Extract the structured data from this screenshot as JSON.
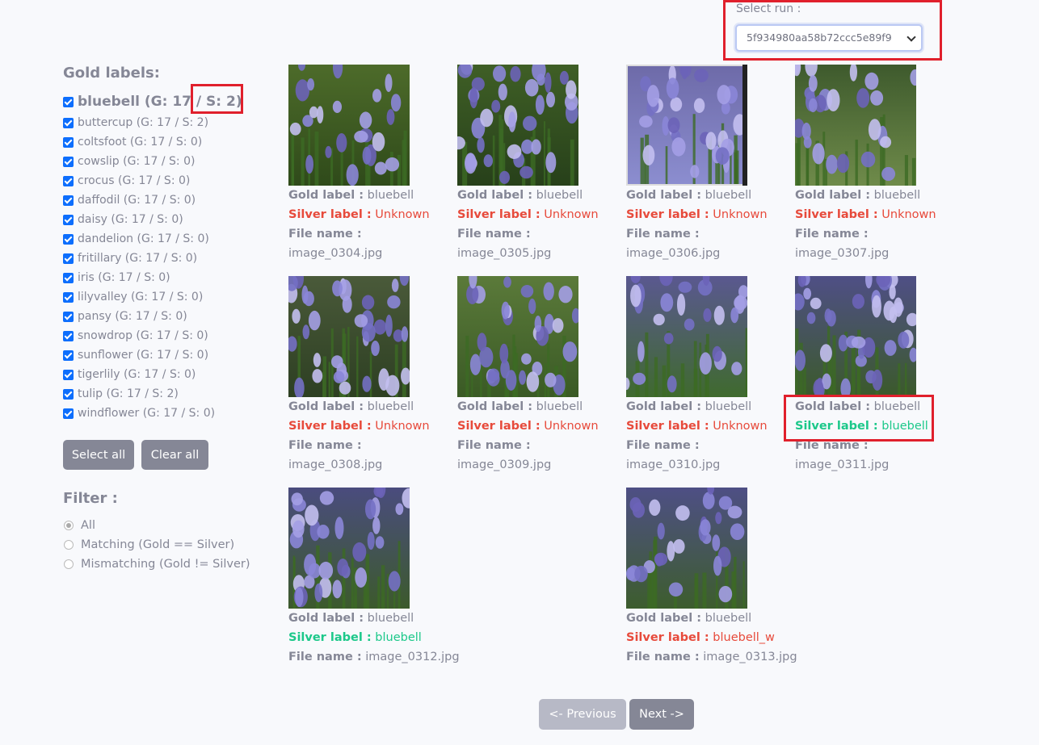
{
  "run_selector": {
    "label": "Select run :",
    "value": "5f934980aa58b72ccc5e89f9"
  },
  "gold_labels": {
    "title": "Gold labels:",
    "items": [
      {
        "label": "bluebell (G: 17 / S: 2)",
        "checked": true
      },
      {
        "label": "buttercup (G: 17 / S: 2)",
        "checked": true
      },
      {
        "label": "coltsfoot (G: 17 / S: 0)",
        "checked": true
      },
      {
        "label": "cowslip (G: 17 / S: 0)",
        "checked": true
      },
      {
        "label": "crocus (G: 17 / S: 0)",
        "checked": true
      },
      {
        "label": "daffodil (G: 17 / S: 0)",
        "checked": true
      },
      {
        "label": "daisy (G: 17 / S: 0)",
        "checked": true
      },
      {
        "label": "dandelion (G: 17 / S: 0)",
        "checked": true
      },
      {
        "label": "fritillary (G: 17 / S: 0)",
        "checked": true
      },
      {
        "label": "iris (G: 17 / S: 0)",
        "checked": true
      },
      {
        "label": "lilyvalley (G: 17 / S: 0)",
        "checked": true
      },
      {
        "label": "pansy (G: 17 / S: 0)",
        "checked": true
      },
      {
        "label": "snowdrop (G: 17 / S: 0)",
        "checked": true
      },
      {
        "label": "sunflower (G: 17 / S: 0)",
        "checked": true
      },
      {
        "label": "tigerlily (G: 17 / S: 0)",
        "checked": true
      },
      {
        "label": "tulip (G: 17 / S: 2)",
        "checked": true
      },
      {
        "label": "windflower (G: 17 / S: 0)",
        "checked": true
      }
    ],
    "select_all": "Select all",
    "clear_all": "Clear all"
  },
  "filter": {
    "title": "Filter :",
    "options": [
      {
        "label": "All",
        "selected": true
      },
      {
        "label": "Matching (Gold == Silver)",
        "selected": false
      },
      {
        "label": "Mismatching (Gold != Silver)",
        "selected": false
      }
    ]
  },
  "field_labels": {
    "gold": "Gold label :",
    "silver": "Silver label :",
    "file": "File name :"
  },
  "images": [
    {
      "gold": "bluebell",
      "silver": "Unknown",
      "match": false,
      "file": "image_0304.jpg"
    },
    {
      "gold": "bluebell",
      "silver": "Unknown",
      "match": false,
      "file": "image_0305.jpg"
    },
    {
      "gold": "bluebell",
      "silver": "Unknown",
      "match": false,
      "file": "image_0306.jpg"
    },
    {
      "gold": "bluebell",
      "silver": "Unknown",
      "match": false,
      "file": "image_0307.jpg"
    },
    {
      "gold": "bluebell",
      "silver": "Unknown",
      "match": false,
      "file": "image_0308.jpg"
    },
    {
      "gold": "bluebell",
      "silver": "Unknown",
      "match": false,
      "file": "image_0309.jpg"
    },
    {
      "gold": "bluebell",
      "silver": "Unknown",
      "match": false,
      "file": "image_0310.jpg"
    },
    {
      "gold": "bluebell",
      "silver": "bluebell",
      "match": true,
      "file": "image_0311.jpg"
    },
    {
      "gold": "bluebell",
      "silver": "bluebell",
      "match": true,
      "file": "image_0312.jpg"
    },
    {
      "gold": "bluebell",
      "silver": "bluebell_w",
      "match": false,
      "file": "image_0313.jpg"
    }
  ],
  "pagination": {
    "prev": "<- Previous",
    "next": "Next ->"
  }
}
